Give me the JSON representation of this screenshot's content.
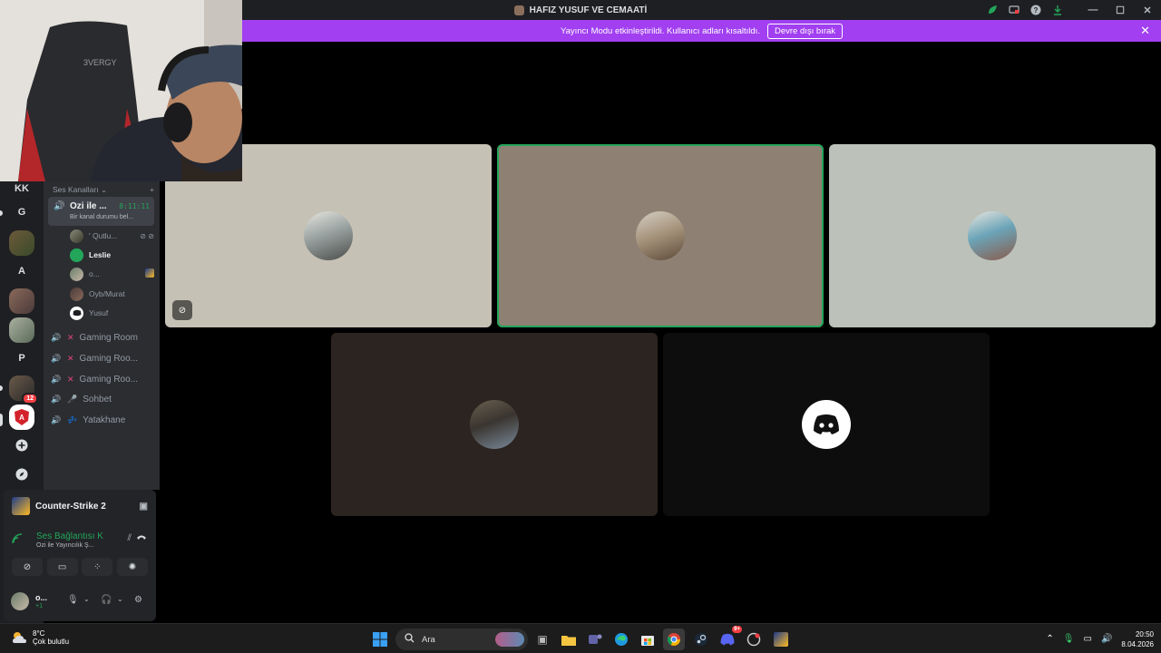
{
  "window": {
    "title": "HAFIZ YUSUF VE CEMAATİ",
    "icons": [
      "leaf-icon",
      "screen-icon",
      "help-icon",
      "download-icon",
      "minimize-icon",
      "maximize-icon",
      "close-icon"
    ]
  },
  "banner": {
    "message": "Yayıncı Modu etkinleştirildi. Kullanıcı adları kısaltıldı.",
    "disable_label": "Devre dışı bırak"
  },
  "rail": {
    "items": [
      "KK",
      "G",
      "A",
      "P"
    ],
    "badge": "12"
  },
  "sidebar": {
    "category": "Ses Kanalları",
    "active_channel": {
      "name": "Ozi ile ...",
      "timer": "8:11:11",
      "status": "Bir kanal durumu bel..."
    },
    "users": [
      {
        "name": "' Qutlu...",
        "bold": false
      },
      {
        "name": "Leslie",
        "bold": true
      },
      {
        "name": "o...",
        "bold": false
      },
      {
        "name": "Oyb/Murat",
        "bold": false
      },
      {
        "name": "Yusuf",
        "bold": false
      }
    ],
    "channels": [
      {
        "name": "Gaming Room",
        "emoji": "✕",
        "color": "#e0457b"
      },
      {
        "name": "Gaming Roo...",
        "emoji": "✕",
        "color": "#e0457b"
      },
      {
        "name": "Gaming Roo...",
        "emoji": "✕",
        "color": "#e0457b"
      },
      {
        "name": "Sohbet",
        "emoji": "🎤",
        "color": "#b5bac1"
      },
      {
        "name": "Yatakhane",
        "emoji": "💤",
        "color": "#5b8cff"
      }
    ]
  },
  "panel": {
    "game": "Counter-Strike 2",
    "connection_title": "Ses Bağlantısı K",
    "connection_sub": "Ozi ile Yayıncılık Ş...",
    "user_name": "o...",
    "user_sub": "+1"
  },
  "taskbar": {
    "temperature": "8°C",
    "weather": "Çok bulutlu",
    "search_placeholder": "Ara",
    "time": "20:50",
    "date": "8.04.2026",
    "discord_badge": "9+"
  }
}
